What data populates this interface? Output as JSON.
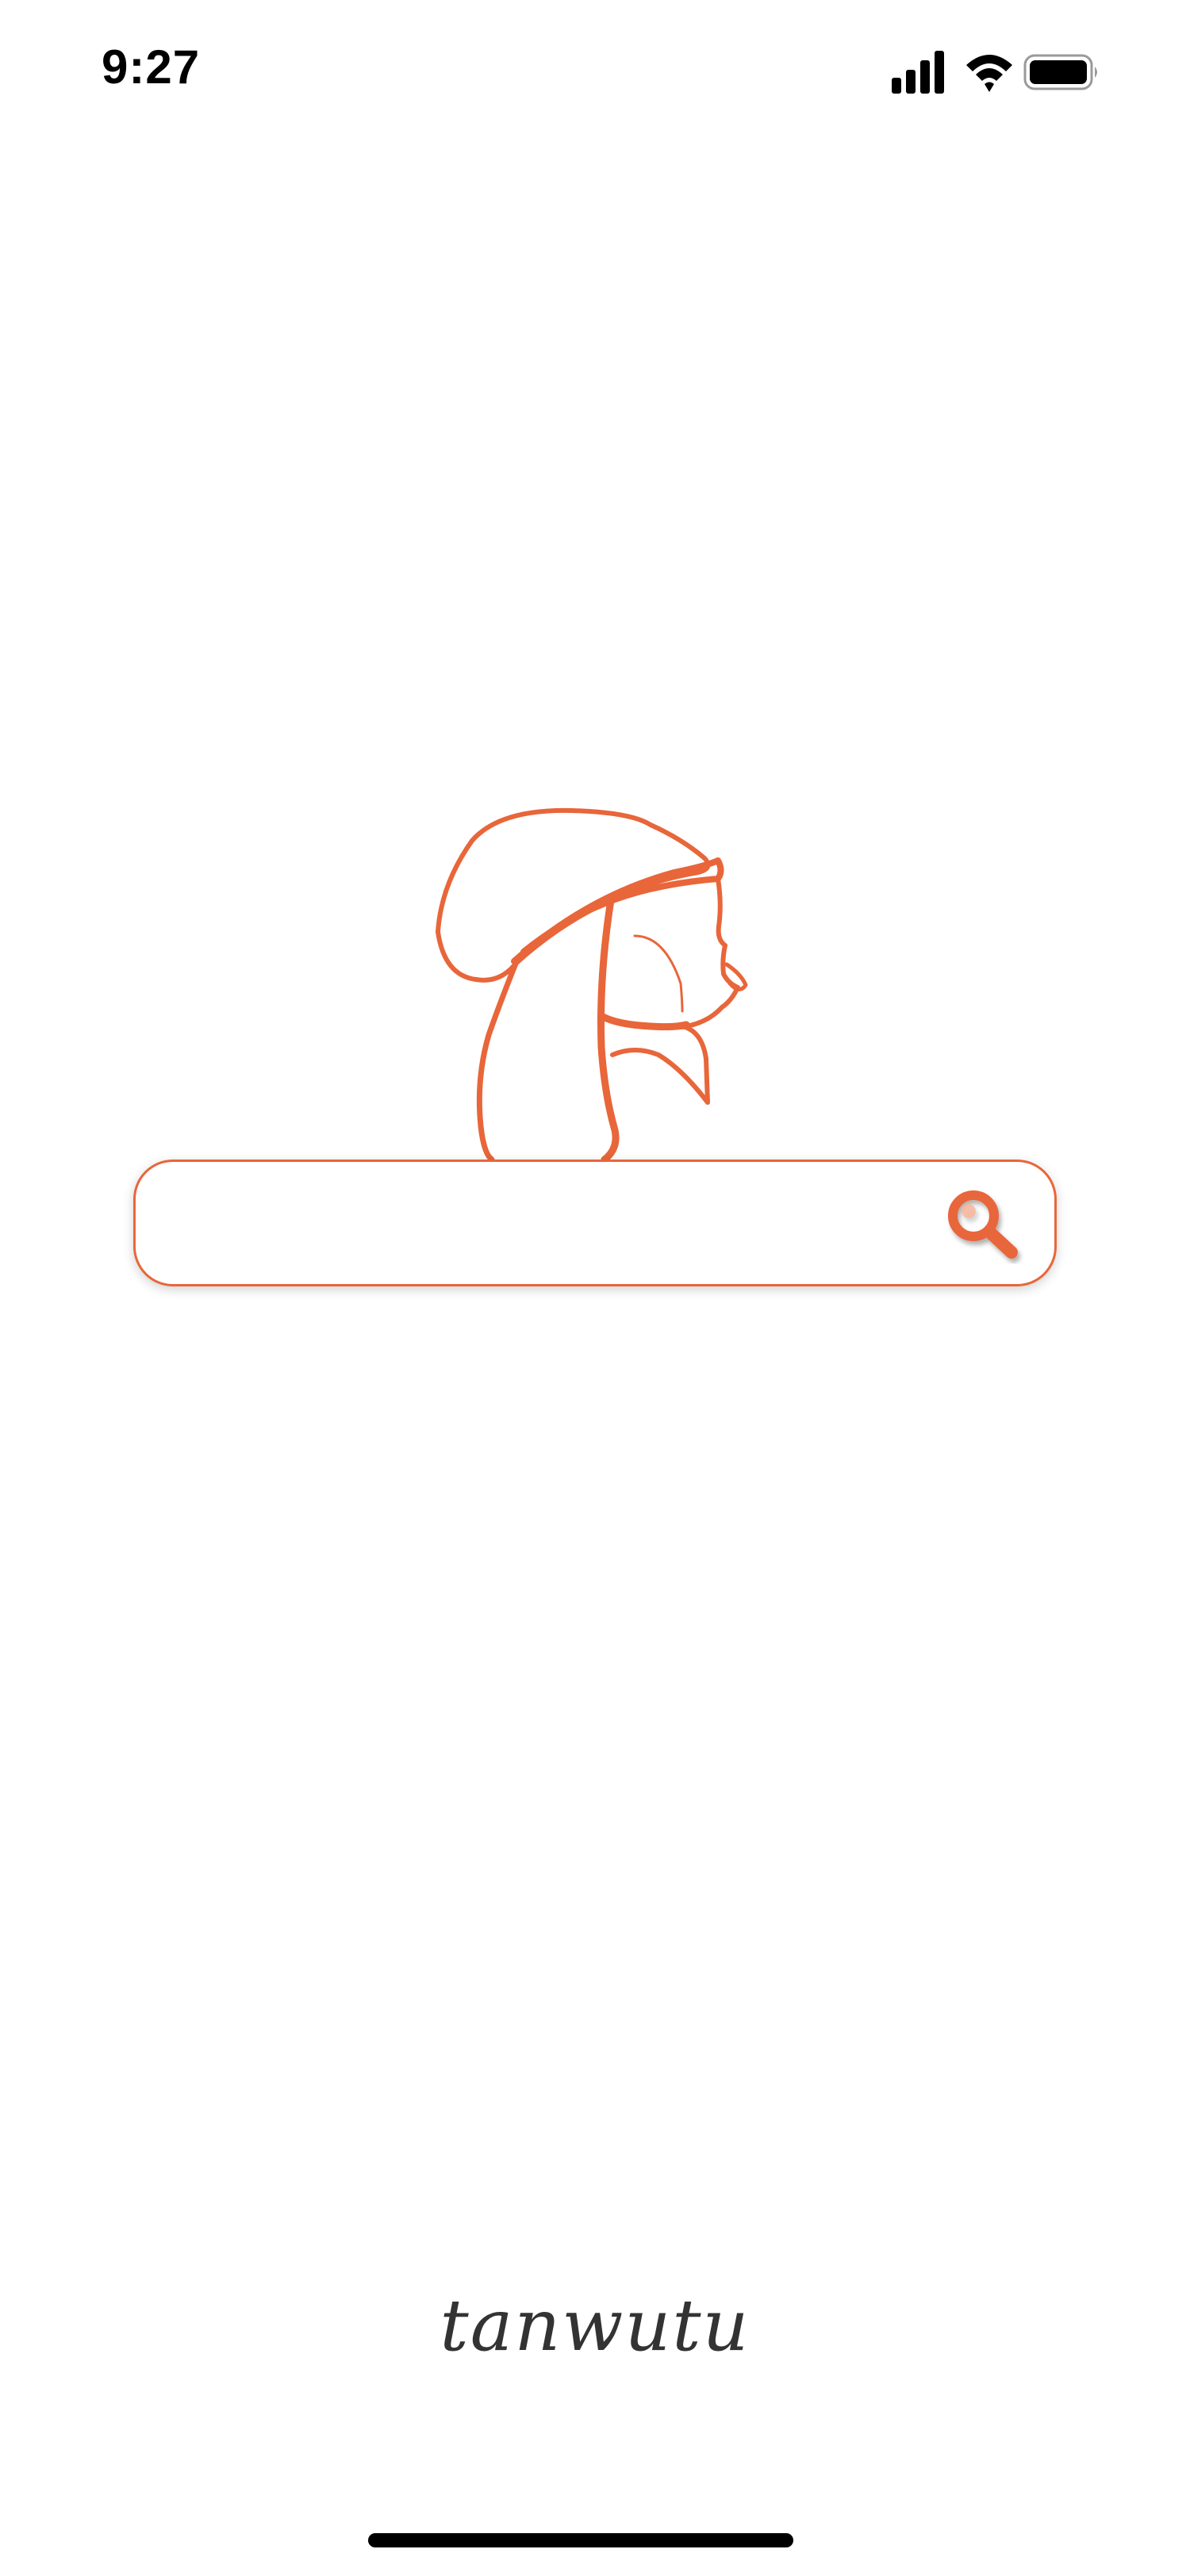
{
  "status_bar": {
    "time": "9:27",
    "icons": [
      "cellular-signal-icon",
      "wifi-icon",
      "battery-icon"
    ]
  },
  "illustration": {
    "icon": "hooded-figure-profile-illustration",
    "stroke_color": "#e8663a"
  },
  "search": {
    "value": "",
    "placeholder": "",
    "icon": "search-icon",
    "accent_color": "#e8663a"
  },
  "brand": {
    "name": "tanwutu"
  }
}
